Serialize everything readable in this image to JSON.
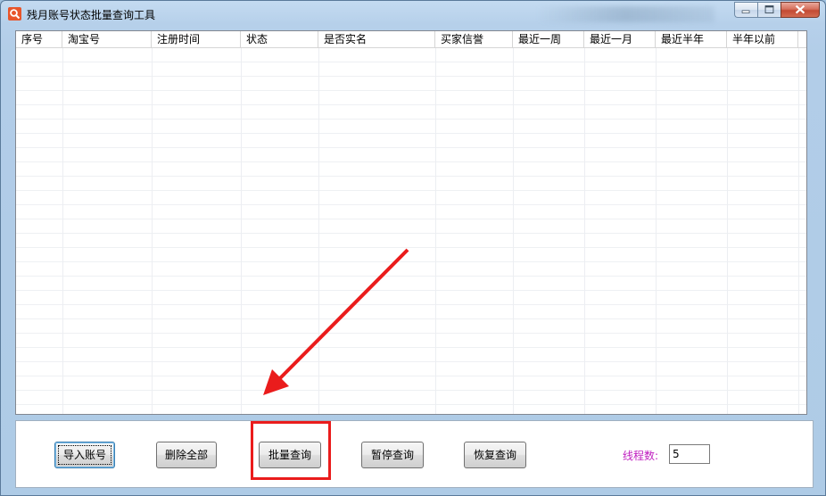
{
  "window": {
    "title": "残月账号状态批量查询工具",
    "app_icon": "magnifier-icon",
    "caption_buttons": [
      "minimize-icon",
      "maximize-icon",
      "close-icon"
    ]
  },
  "table": {
    "columns": [
      "序号",
      "淘宝号",
      "注册时间",
      "状态",
      "是否实名",
      "买家信誉",
      "最近一周",
      "最近一月",
      "最近半年",
      "半年以前"
    ],
    "rows": []
  },
  "actions": {
    "import": "导入账号",
    "delete_all": "删除全部",
    "batch_query": "批量查询",
    "pause": "暂停查询",
    "resume": "恢复查询"
  },
  "threads": {
    "label": "线程数:",
    "value": "5"
  },
  "annotation": {
    "color": "#ea1c1c",
    "highlighted": "batch_query"
  }
}
